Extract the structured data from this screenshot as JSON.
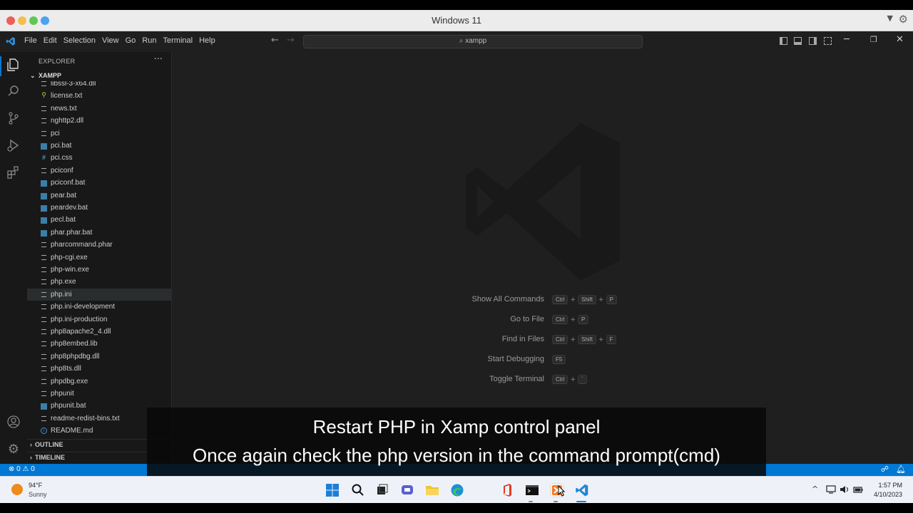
{
  "window": {
    "title": "Windows 11"
  },
  "menubar": {
    "items": [
      "File",
      "Edit",
      "Selection",
      "View",
      "Go",
      "Run",
      "Terminal",
      "Help"
    ],
    "command_center": "xampp"
  },
  "sidebar": {
    "header": "EXPLORER",
    "folder": "XAMPP",
    "files": [
      {
        "name": "libssl-3-x64.dll",
        "icon": "text-file-icon"
      },
      {
        "name": "license.txt",
        "icon": "license-icon"
      },
      {
        "name": "news.txt",
        "icon": "text-file-icon"
      },
      {
        "name": "nghttp2.dll",
        "icon": "text-file-icon"
      },
      {
        "name": "pci",
        "icon": "text-file-icon"
      },
      {
        "name": "pci.bat",
        "icon": "bat-file-icon"
      },
      {
        "name": "pci.css",
        "icon": "css-file-icon"
      },
      {
        "name": "pciconf",
        "icon": "text-file-icon"
      },
      {
        "name": "pciconf.bat",
        "icon": "bat-file-icon"
      },
      {
        "name": "pear.bat",
        "icon": "bat-file-icon"
      },
      {
        "name": "peardev.bat",
        "icon": "bat-file-icon"
      },
      {
        "name": "pecl.bat",
        "icon": "bat-file-icon"
      },
      {
        "name": "phar.phar.bat",
        "icon": "bat-file-icon"
      },
      {
        "name": "pharcommand.phar",
        "icon": "text-file-icon"
      },
      {
        "name": "php-cgi.exe",
        "icon": "text-file-icon"
      },
      {
        "name": "php-win.exe",
        "icon": "text-file-icon"
      },
      {
        "name": "php.exe",
        "icon": "text-file-icon"
      },
      {
        "name": "php.ini",
        "icon": "text-file-icon",
        "selected": true
      },
      {
        "name": "php.ini-development",
        "icon": "text-file-icon"
      },
      {
        "name": "php.ini-production",
        "icon": "text-file-icon"
      },
      {
        "name": "php8apache2_4.dll",
        "icon": "text-file-icon"
      },
      {
        "name": "php8embed.lib",
        "icon": "text-file-icon"
      },
      {
        "name": "php8phpdbg.dll",
        "icon": "text-file-icon"
      },
      {
        "name": "php8ts.dll",
        "icon": "text-file-icon"
      },
      {
        "name": "phpdbg.exe",
        "icon": "text-file-icon"
      },
      {
        "name": "phpunit",
        "icon": "text-file-icon"
      },
      {
        "name": "phpunit.bat",
        "icon": "bat-file-icon"
      },
      {
        "name": "readme-redist-bins.txt",
        "icon": "text-file-icon"
      },
      {
        "name": "README.md",
        "icon": "info-file-icon"
      }
    ],
    "outline": "OUTLINE",
    "timeline": "TIMELINE"
  },
  "editor": {
    "shortcuts": [
      {
        "label": "Show All Commands",
        "keys": [
          "Ctrl",
          "Shift",
          "P"
        ]
      },
      {
        "label": "Go to File",
        "keys": [
          "Ctrl",
          "P"
        ]
      },
      {
        "label": "Find in Files",
        "keys": [
          "Ctrl",
          "Shift",
          "F"
        ]
      },
      {
        "label": "Start Debugging",
        "keys": [
          "F5"
        ]
      },
      {
        "label": "Toggle Terminal",
        "keys": [
          "Ctrl",
          "`"
        ]
      }
    ]
  },
  "statusbar": {
    "problems": "⊗ 0 ⚠ 0"
  },
  "subtitles": {
    "line1": "Restart PHP in Xamp control panel",
    "line2": "Once again check the php version in the command prompt(cmd)"
  },
  "taskbar": {
    "weather_temp": "94°F",
    "weather_condition": "Sunny",
    "time": "1:57 PM",
    "date": "4/10/2023"
  },
  "colors": {
    "accent": "#0078d4",
    "editor_bg": "#1f1f1f",
    "sidebar_bg": "#181818"
  }
}
